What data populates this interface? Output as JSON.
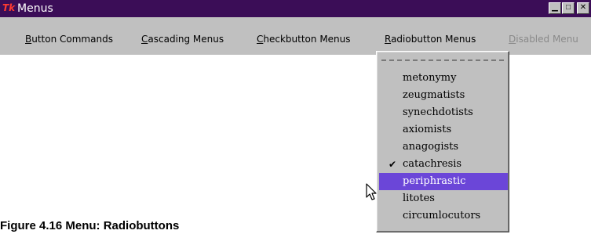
{
  "window": {
    "title": "Menus",
    "icon_text": "Tk",
    "titlebar_color": "#3b0d57",
    "controls": {
      "minimize": "▁",
      "maximize": "□",
      "close": "✕"
    }
  },
  "menubar": {
    "items": [
      {
        "label": "Button Commands",
        "enabled": true
      },
      {
        "label": "Cascading Menus",
        "enabled": true
      },
      {
        "label": "Checkbutton Menus",
        "enabled": true
      },
      {
        "label": "Radiobutton Menus",
        "enabled": true,
        "open": true
      },
      {
        "label": "Disabled Menu",
        "enabled": false
      }
    ]
  },
  "dropdown": {
    "has_tearoff": true,
    "options": [
      {
        "label": "metonymy"
      },
      {
        "label": "zeugmatists"
      },
      {
        "label": "synechdotists"
      },
      {
        "label": "axiomists"
      },
      {
        "label": "anagogists"
      },
      {
        "label": "catachresis",
        "selected": true,
        "check": "✔"
      },
      {
        "label": "periphrastic",
        "highlighted": true
      },
      {
        "label": "litotes"
      },
      {
        "label": "circumlocutors"
      }
    ],
    "highlight_color": "#6b46d8"
  },
  "caption": "Figure 4.16  Menu: Radiobuttons"
}
